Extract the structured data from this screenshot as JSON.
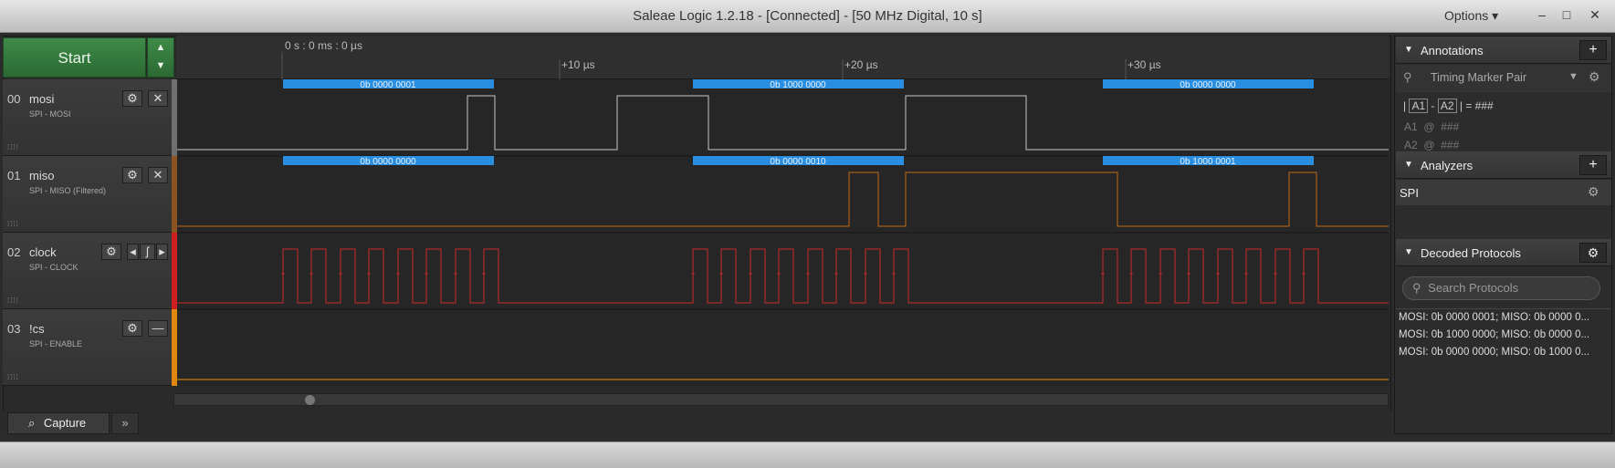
{
  "window": {
    "title": "Saleae Logic 1.2.18 - [Connected] - [50 MHz Digital, 10 s]",
    "options_label": "Options",
    "minimize": "–",
    "maximize": "□",
    "close": "✕"
  },
  "toolbar": {
    "start_label": "Start",
    "up_arrow": "▲",
    "down_arrow": "▼"
  },
  "timeline": {
    "origin": "0 s : 0 ms : 0 µs",
    "ticks": [
      "+10 µs",
      "+20 µs",
      "+30 µs"
    ]
  },
  "channels": [
    {
      "num": "00",
      "name": "mosi",
      "sub": "SPI - MOSI",
      "color": "#7a7a7a"
    },
    {
      "num": "01",
      "name": "miso",
      "sub": "SPI - MISO (Filtered)",
      "color": "#9a5a1e"
    },
    {
      "num": "02",
      "name": "clock",
      "sub": "SPI - CLOCK",
      "color": "#cc2222"
    },
    {
      "num": "03",
      "name": "!cs",
      "sub": "SPI - ENABLE",
      "color": "#e38a12"
    }
  ],
  "icons": {
    "gear": "⚙",
    "close": "✕",
    "minimize": "—",
    "arrow_left": "◂",
    "arrow_right": "▸",
    "rising_edge": "ʃ",
    "grip": "⁞⁞⁞⁞"
  },
  "mosi_bytes": [
    "0b 0000 0001",
    "0b 1000 0000",
    "0b 0000 0000"
  ],
  "miso_bytes": [
    "0b 0000 0000",
    "0b 0000 0010",
    "0b 1000 0001"
  ],
  "colors": {
    "decode": "#2a8ee0",
    "mosi": "#c8c8c8",
    "miso": "#c06a1a",
    "clock": "#cc2a2a",
    "cs": "#e8920f",
    "start": "#2f7a3a"
  },
  "bottom": {
    "capture_label": "Capture",
    "more_label": "»"
  },
  "annotations": {
    "title": "Annotations",
    "add": "+",
    "marker_pair": "Timing Marker Pair",
    "a1": "A1",
    "a2": "A2",
    "dash": "-",
    "equals": "= ###",
    "at": "@",
    "hash": "###"
  },
  "analyzers": {
    "title": "Analyzers",
    "add": "+",
    "items": [
      "SPI"
    ]
  },
  "decoded": {
    "title": "Decoded Protocols",
    "search_placeholder": "Search Protocols",
    "rows": [
      "MOSI: 0b 0000 0001;  MISO: 0b 0000 0...",
      "MOSI: 0b 1000 0000;  MISO: 0b 0000 0...",
      "MOSI: 0b 0000 0000;  MISO: 0b 1000 0..."
    ]
  }
}
